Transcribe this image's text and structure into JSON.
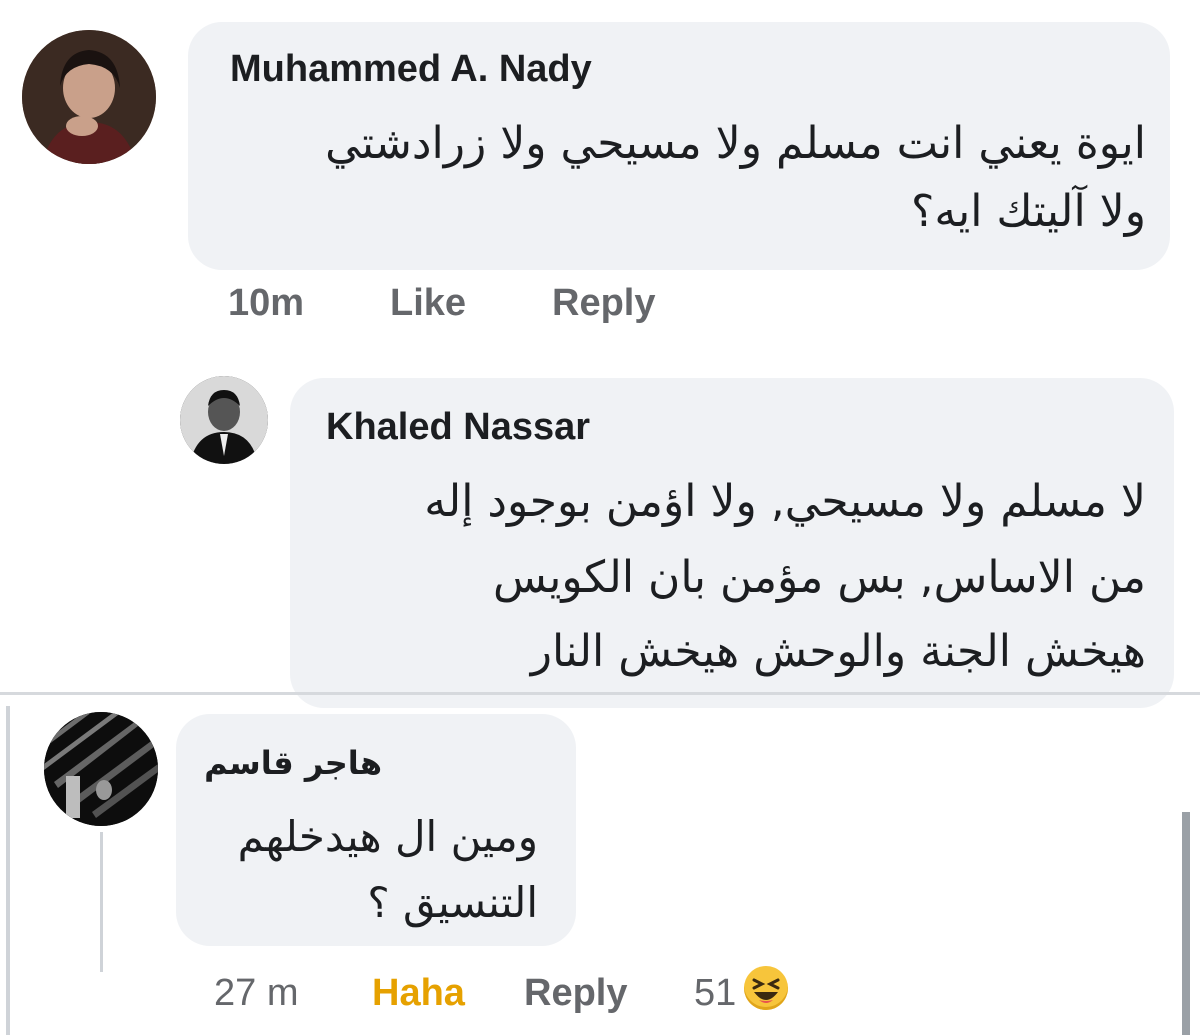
{
  "comments": [
    {
      "author": "Muhammed A. Nady",
      "lines": [
        "ايوة يعني انت مسلم ولا مسيحي ولا زرادشتي",
        "ولا آليتك ايه؟"
      ],
      "time": "10m",
      "like_label": "Like",
      "reply_label": "Reply"
    },
    {
      "author": "Khaled Nassar",
      "lines": [
        "لا مسلم ولا مسيحي, ولا اؤمن بوجود إله",
        "من الاساس, بس مؤمن بان الكويس",
        "هيخش الجنة والوحش هيخش النار"
      ]
    },
    {
      "author": "هاجر قاسم",
      "lines": [
        "ومين ال هيدخلهم",
        "التنسيق ؟"
      ],
      "time": "27 m",
      "haha_label": "Haha",
      "reply_label": "Reply",
      "reaction_count": "51",
      "reaction_icon": "laughing-emoji-icon"
    }
  ],
  "colors": {
    "bubble": "#f0f2f5",
    "text": "#1c1e21",
    "meta": "#65676b",
    "haha": "#e6a100"
  }
}
